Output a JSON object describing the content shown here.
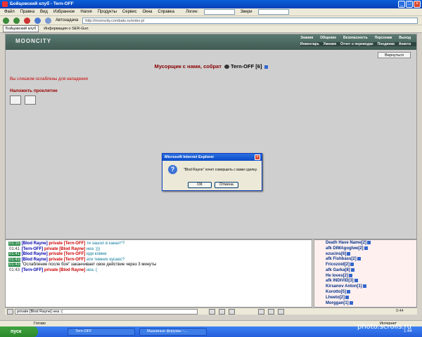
{
  "window": {
    "title": "Бойцовский клуб - Tern-OFF"
  },
  "menu": {
    "items": [
      "Файл",
      "Правка",
      "Вид",
      "Избранное",
      "Нагия",
      "Продукты",
      "Сервис",
      "Окна",
      "Справка"
    ],
    "login_label": "Логин:",
    "beasts_label": "Звери"
  },
  "toolbar": {
    "autofill": "Автозадача",
    "address": "http://mooncity.combats.ru/enter.pl"
  },
  "favorites": {
    "items": [
      "Бойцовский клуб",
      "Информация о SER-Gun"
    ]
  },
  "site": {
    "logo": "MOONCITY",
    "nav": [
      "Знания",
      "Общение",
      "Безопасность",
      "Персонаж",
      "Выход"
    ],
    "subnav": [
      "Инвентарь",
      "Умения",
      "Отчет о переводах",
      "Поединки",
      "Анкета"
    ],
    "return_btn": "Вернуться",
    "heading": "Мусорщик с нами, собрат",
    "heading_player": "Tern-OFF",
    "heading_level": "[6]",
    "weak_msg": "Вы слишком ослаблены для нападения",
    "curse_label": "Наложить проклятие"
  },
  "dialog": {
    "title": "Microsoft Internet Explorer",
    "message": "\"Blod Rayne\" хочет совершить с вами сделку.",
    "ok": "ОК",
    "cancel": "Отмена"
  },
  "chat": [
    {
      "time": "01:15",
      "nick": "[Blod Rayne]",
      "priv": "private [Tern-OFF]",
      "msg": "ти зашол в канал^?"
    },
    {
      "time": "01:41",
      "nick": "[Tern-OFF]",
      "priv": "private [Blod Rayne]",
      "msg": "неа :)))"
    },
    {
      "time": "01:41",
      "nick": "[Blod Rayne]",
      "priv": "private [Tern-OFF]",
      "msg": "иди комне"
    },
    {
      "time": "01:43",
      "nick": "[Blod Rayne]",
      "priv": "private [Tern-OFF]",
      "msg": "ати темних кусаес?"
    },
    {
      "time": "01:43",
      "nick": "",
      "priv": "",
      "msg": "\"Ослабление после боя\" заканчивает свое действие через 3 минуты"
    },
    {
      "time": "01:43",
      "nick": "[Tern-OFF]",
      "priv": "private [Blod Rayne]",
      "msg": "неа :("
    }
  ],
  "users": [
    {
      "name": "Death Have Name",
      "lvl": "[2]"
    },
    {
      "name": "afk DIMAgoglwe",
      "lvl": "[2]"
    },
    {
      "name": "ezucins",
      "lvl": "[6]"
    },
    {
      "name": "afk Fishbass",
      "lvl": "[2]"
    },
    {
      "name": "Fricozoid",
      "lvl": "[2]"
    },
    {
      "name": "afk Garka",
      "lvl": "[8]"
    },
    {
      "name": "He loves",
      "lvl": "[2]"
    },
    {
      "name": "afk INDIVID",
      "lvl": "[3]"
    },
    {
      "name": "Kirsanov Anton",
      "lvl": "[1]"
    },
    {
      "name": "Korotto",
      "lvl": "[5]"
    },
    {
      "name": "Lheeto",
      "lvl": "[2]"
    },
    {
      "name": "Morggan",
      "lvl": "[1]"
    }
  ],
  "input": {
    "value": "private [Blod Rayne] неа :("
  },
  "clock": "0:44",
  "status": {
    "left": "Готово",
    "right": "Интернет"
  },
  "taskbar": {
    "start": "пуск",
    "tasks": [
      "Tern-OFF",
      "Мышиные форумы ::..."
    ],
    "time": "1:44"
  },
  "watermark": "photo.scrolls.ru"
}
